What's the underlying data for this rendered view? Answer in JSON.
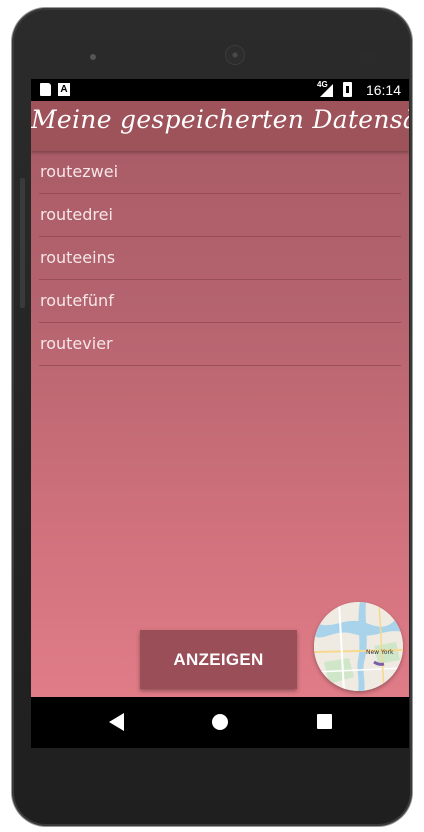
{
  "status_bar": {
    "network": "4G",
    "time": "16:14",
    "icons": [
      "sd-card-icon",
      "a-icon",
      "signal-icon",
      "battery-icon"
    ]
  },
  "app": {
    "title": "Meine gespeicherten Datensätze",
    "routes": [
      "routezwei",
      "routedrei",
      "routeeins",
      "routefünf",
      "routevier"
    ],
    "show_button_label": "ANZEIGEN",
    "map_button_label": "New York"
  },
  "colors": {
    "header": "#9e535b",
    "gradient_top": "#a75a64",
    "gradient_bottom": "#e07c87",
    "button": "#9a4e58"
  },
  "nav_bar": {
    "icons": [
      "back-icon",
      "home-icon",
      "recents-icon"
    ]
  }
}
